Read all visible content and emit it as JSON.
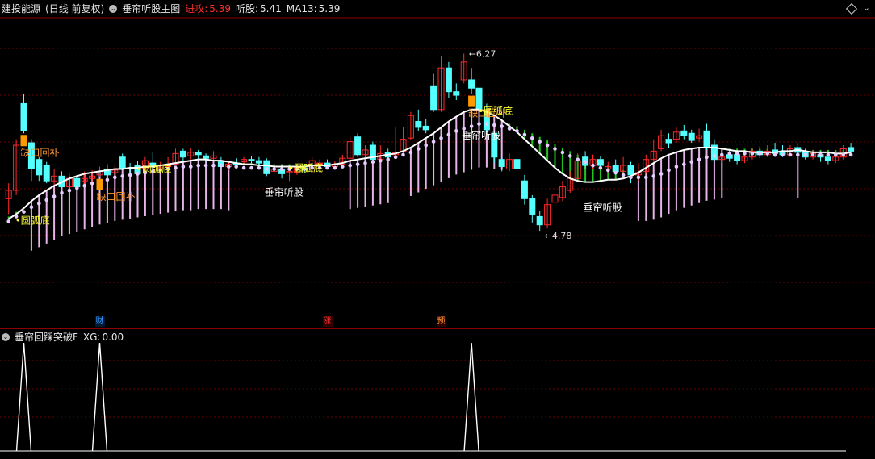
{
  "main_header": {
    "stock": "建投能源",
    "mode": "(日线 前复权)",
    "indicator": "垂帘听股主图",
    "attack_label": "进攻:",
    "attack_value": "5.39",
    "listen_label": "听股:",
    "listen_value": "5.41",
    "ma_label": "MA13:",
    "ma_value": "5.39"
  },
  "sub_header": {
    "indicator": "垂帘回踩突破F",
    "xg_label": "XG:",
    "xg_value": "0.00"
  },
  "events": [
    {
      "text": "财",
      "color": "#3399ff"
    },
    {
      "text": "涨",
      "color": "#ff3333"
    },
    {
      "text": "预",
      "color": "#ff9933"
    }
  ],
  "colors": {
    "up": "#ff2a2a",
    "down": "#54ffff",
    "ma": "#ffffff",
    "dots": "#e6ccff",
    "pink_bars": "#ffc8ff",
    "green_bars": "#22dd22",
    "gap": "#ff9900",
    "label_yellow": "#ffff33",
    "label_orange": "#ff9933"
  },
  "chart_data": {
    "type": "candlestick",
    "ylim": [
      4.55,
      6.45
    ],
    "annotations": {
      "high_label": "6.27",
      "high_value": 6.27,
      "low_label": "4.78",
      "low_value": 4.78,
      "gap_fill": "缺口回补",
      "turtle_bottom": "圆弧底",
      "listen_stock": "垂帘听股"
    },
    "candles": [
      [
        5.05,
        5.12,
        5.18,
        4.92
      ],
      [
        5.12,
        5.5,
        5.55,
        5.08
      ],
      [
        5.85,
        5.62,
        5.93,
        5.6
      ],
      [
        5.52,
        5.3,
        5.55,
        5.2
      ],
      [
        5.38,
        5.25,
        5.4,
        5.2
      ],
      [
        5.33,
        5.2,
        5.36,
        5.18
      ],
      [
        5.2,
        5.24,
        5.3,
        5.16
      ],
      [
        5.24,
        5.15,
        5.28,
        5.12
      ],
      [
        5.15,
        5.22,
        5.26,
        5.12
      ],
      [
        5.22,
        5.15,
        5.25,
        5.1
      ],
      [
        5.2,
        5.22,
        5.28,
        5.16
      ],
      [
        5.22,
        5.24,
        5.29,
        5.18
      ],
      [
        5.25,
        5.28,
        5.32,
        5.23
      ],
      [
        5.3,
        5.25,
        5.34,
        5.23
      ],
      [
        5.27,
        5.29,
        5.33,
        5.24
      ],
      [
        5.4,
        5.31,
        5.43,
        5.29
      ],
      [
        5.31,
        5.3,
        5.35,
        5.26
      ],
      [
        5.33,
        5.26,
        5.37,
        5.24
      ],
      [
        5.3,
        5.37,
        5.4,
        5.28
      ],
      [
        5.35,
        5.32,
        5.44,
        5.3
      ],
      [
        5.3,
        5.31,
        5.36,
        5.28
      ],
      [
        5.32,
        5.34,
        5.4,
        5.3
      ],
      [
        5.34,
        5.43,
        5.47,
        5.32
      ],
      [
        5.45,
        5.4,
        5.47,
        5.36
      ],
      [
        5.41,
        5.44,
        5.48,
        5.38
      ],
      [
        5.44,
        5.42,
        5.46,
        5.38
      ],
      [
        5.41,
        5.39,
        5.43,
        5.36
      ],
      [
        5.39,
        5.41,
        5.45,
        5.37
      ],
      [
        5.36,
        5.32,
        5.4,
        5.3
      ],
      [
        5.32,
        5.34,
        5.37,
        5.29
      ],
      [
        5.35,
        5.34,
        5.39,
        5.32
      ],
      [
        5.36,
        5.38,
        5.4,
        5.33
      ],
      [
        5.38,
        5.37,
        5.41,
        5.35
      ],
      [
        5.37,
        5.35,
        5.4,
        5.33
      ],
      [
        5.37,
        5.26,
        5.39,
        5.24
      ],
      [
        5.28,
        5.3,
        5.34,
        5.26
      ],
      [
        5.3,
        5.26,
        5.33,
        5.22
      ],
      [
        5.27,
        5.28,
        5.32,
        5.2
      ],
      [
        5.27,
        5.31,
        5.34,
        5.25
      ],
      [
        5.31,
        5.29,
        5.34,
        5.27
      ],
      [
        5.3,
        5.37,
        5.4,
        5.28
      ],
      [
        5.35,
        5.35,
        5.38,
        5.32
      ],
      [
        5.35,
        5.32,
        5.38,
        5.3
      ],
      [
        5.32,
        5.34,
        5.37,
        5.3
      ],
      [
        5.34,
        5.39,
        5.42,
        5.32
      ],
      [
        5.39,
        5.53,
        5.57,
        5.37
      ],
      [
        5.57,
        5.42,
        5.6,
        5.4
      ],
      [
        5.42,
        5.46,
        5.5,
        5.38
      ],
      [
        5.5,
        5.38,
        5.53,
        5.36
      ],
      [
        5.38,
        5.43,
        5.5,
        5.36
      ],
      [
        5.44,
        5.4,
        5.47,
        5.38
      ],
      [
        5.42,
        5.44,
        5.65,
        5.4
      ],
      [
        5.45,
        5.55,
        5.65,
        5.43
      ],
      [
        5.56,
        5.75,
        5.78,
        5.54
      ],
      [
        5.7,
        5.65,
        5.8,
        5.62
      ],
      [
        5.66,
        5.63,
        5.72,
        5.6
      ],
      [
        6.0,
        5.8,
        6.1,
        5.78
      ],
      [
        5.8,
        6.15,
        6.25,
        5.78
      ],
      [
        6.15,
        5.95,
        6.2,
        5.9
      ],
      [
        5.95,
        5.92,
        6.02,
        5.88
      ],
      [
        6.05,
        6.2,
        6.27,
        6.02
      ],
      [
        6.05,
        5.98,
        6.15,
        5.93
      ],
      [
        5.98,
        5.8,
        6.0,
        5.72
      ],
      [
        5.8,
        5.63,
        5.85,
        5.6
      ],
      [
        5.6,
        5.4,
        5.62,
        5.35
      ],
      [
        5.38,
        5.32,
        5.4,
        5.28
      ],
      [
        5.3,
        5.38,
        5.43,
        5.28
      ],
      [
        5.38,
        5.3,
        5.4,
        5.25
      ],
      [
        5.2,
        5.05,
        5.25,
        5.0
      ],
      [
        5.05,
        4.92,
        5.08,
        4.85
      ],
      [
        4.9,
        4.83,
        4.95,
        4.78
      ],
      [
        4.83,
        5.0,
        5.05,
        4.8
      ],
      [
        5.02,
        5.08,
        5.12,
        4.98
      ],
      [
        5.06,
        5.15,
        5.2,
        5.03
      ],
      [
        5.12,
        5.22,
        5.28,
        5.1
      ],
      [
        5.22,
        5.37,
        5.43,
        5.2
      ],
      [
        5.4,
        5.33,
        5.45,
        5.3
      ],
      [
        5.33,
        5.38,
        5.42,
        5.3
      ],
      [
        5.38,
        5.33,
        5.41,
        5.3
      ],
      [
        5.3,
        5.32,
        5.36,
        5.27
      ],
      [
        5.33,
        5.28,
        5.38,
        5.25
      ],
      [
        5.28,
        5.33,
        5.4,
        5.26
      ],
      [
        5.33,
        5.25,
        5.36,
        5.18
      ],
      [
        5.25,
        5.27,
        5.35,
        5.2
      ],
      [
        5.28,
        5.38,
        5.42,
        5.26
      ],
      [
        5.38,
        5.45,
        5.55,
        5.36
      ],
      [
        5.47,
        5.58,
        5.63,
        5.45
      ],
      [
        5.55,
        5.52,
        5.6,
        5.48
      ],
      [
        5.55,
        5.61,
        5.65,
        5.52
      ],
      [
        5.62,
        5.58,
        5.67,
        5.55
      ],
      [
        5.6,
        5.54,
        5.63,
        5.52
      ],
      [
        5.56,
        5.58,
        5.64,
        5.53
      ],
      [
        5.62,
        5.48,
        5.68,
        5.46
      ],
      [
        5.5,
        5.38,
        5.55,
        5.36
      ],
      [
        5.38,
        5.4,
        5.45,
        5.35
      ],
      [
        5.42,
        5.39,
        5.46,
        5.36
      ],
      [
        5.42,
        5.37,
        5.45,
        5.34
      ],
      [
        5.37,
        5.4,
        5.44,
        5.35
      ],
      [
        5.4,
        5.45,
        5.48,
        5.38
      ],
      [
        5.45,
        5.42,
        5.49,
        5.39
      ],
      [
        5.42,
        5.45,
        5.5,
        5.4
      ],
      [
        5.46,
        5.43,
        5.52,
        5.4
      ],
      [
        5.45,
        5.42,
        5.5,
        5.4
      ],
      [
        5.42,
        5.47,
        5.5,
        5.41
      ],
      [
        5.48,
        5.44,
        5.52,
        5.42
      ],
      [
        5.44,
        5.4,
        5.47,
        5.38
      ],
      [
        5.4,
        5.43,
        5.46,
        5.38
      ],
      [
        5.42,
        5.4,
        5.45,
        5.36
      ],
      [
        5.4,
        5.37,
        5.43,
        5.34
      ],
      [
        5.37,
        5.4,
        5.44,
        5.35
      ],
      [
        5.4,
        5.47,
        5.5,
        5.38
      ],
      [
        5.48,
        5.45,
        5.52,
        5.42
      ]
    ],
    "ma13": [
      4.88,
      4.92,
      4.97,
      5.03,
      5.08,
      5.12,
      5.16,
      5.19,
      5.22,
      5.24,
      5.26,
      5.27,
      5.28,
      5.29,
      5.3,
      5.3,
      5.31,
      5.31,
      5.32,
      5.32,
      5.33,
      5.34,
      5.35,
      5.36,
      5.37,
      5.38,
      5.38,
      5.37,
      5.37,
      5.36,
      5.35,
      5.34,
      5.34,
      5.33,
      5.33,
      5.32,
      5.32,
      5.32,
      5.32,
      5.32,
      5.33,
      5.33,
      5.33,
      5.34,
      5.35,
      5.37,
      5.38,
      5.39,
      5.4,
      5.41,
      5.42,
      5.43,
      5.45,
      5.48,
      5.52,
      5.56,
      5.6,
      5.65,
      5.7,
      5.74,
      5.78,
      5.8,
      5.8,
      5.78,
      5.75,
      5.71,
      5.66,
      5.61,
      5.55,
      5.49,
      5.43,
      5.37,
      5.31,
      5.26,
      5.22,
      5.2,
      5.19,
      5.19,
      5.2,
      5.21,
      5.21,
      5.22,
      5.24,
      5.27,
      5.31,
      5.35,
      5.39,
      5.42,
      5.44,
      5.46,
      5.47,
      5.48,
      5.48,
      5.48,
      5.47,
      5.46,
      5.45,
      5.45,
      5.44,
      5.44,
      5.44,
      5.44,
      5.45,
      5.45,
      5.46,
      5.45,
      5.44,
      5.44,
      5.44,
      5.43,
      5.43,
      5.44
    ],
    "dots": [
      4.9,
      4.94,
      4.98,
      5.02,
      5.05,
      5.08,
      5.11,
      5.14,
      5.16,
      5.18,
      5.2,
      5.22,
      5.24,
      5.25,
      5.27,
      5.28,
      5.29,
      5.3,
      5.31,
      5.32,
      5.33,
      5.34,
      5.35,
      5.36,
      5.36,
      5.37,
      5.37,
      5.37,
      5.37,
      5.36,
      5.36,
      5.35,
      5.35,
      5.35,
      5.34,
      5.34,
      5.34,
      5.34,
      5.34,
      5.34,
      5.35,
      5.35,
      5.35,
      5.35,
      5.36,
      5.37,
      5.38,
      5.39,
      5.4,
      5.41,
      5.42,
      5.44,
      5.46,
      5.48,
      5.51,
      5.54,
      5.57,
      5.6,
      5.63,
      5.66,
      5.68,
      5.7,
      5.72,
      5.72,
      5.71,
      5.7,
      5.68,
      5.66,
      5.63,
      5.6,
      5.57,
      5.54,
      5.51,
      5.48,
      5.45,
      5.42,
      5.4,
      5.37,
      5.35,
      5.33,
      5.31,
      5.29,
      5.27,
      5.27,
      5.27,
      5.28,
      5.3,
      5.33,
      5.36,
      5.38,
      5.4,
      5.42,
      5.44,
      5.45,
      5.46,
      5.47,
      5.47,
      5.47,
      5.47,
      5.47,
      5.47,
      5.46,
      5.46,
      5.46,
      5.46,
      5.46,
      5.46,
      5.46,
      5.46,
      5.46,
      5.46,
      5.46
    ],
    "gap_markers": [
      2,
      12,
      61
    ],
    "signals": [
      2,
      12,
      61
    ],
    "turtle_marks": [
      0,
      16,
      36,
      61
    ],
    "listen_marks": [
      35,
      61,
      77
    ],
    "event_indices": [
      12,
      42,
      57
    ]
  }
}
